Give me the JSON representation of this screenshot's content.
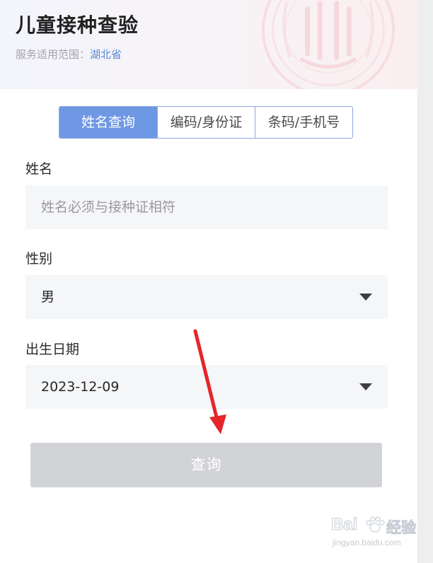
{
  "header": {
    "title": "儿童接种查验",
    "scope_label": "服务适用范围：",
    "scope_value": "湖北省"
  },
  "tabs": [
    {
      "label": "姓名查询",
      "active": true
    },
    {
      "label": "编码/身份证",
      "active": false
    },
    {
      "label": "条码/手机号",
      "active": false
    }
  ],
  "form": {
    "name": {
      "label": "姓名",
      "placeholder": "姓名必须与接种证相符",
      "value": ""
    },
    "gender": {
      "label": "性别",
      "value": "男"
    },
    "birthdate": {
      "label": "出生日期",
      "value": "2023-12-09"
    }
  },
  "submit_label": "查询",
  "watermark": {
    "brand": "Bai",
    "brand_suffix": "经验",
    "url": "jingyan.baidu.com"
  },
  "colors": {
    "accent": "#6f98e4",
    "link": "#5b86d6",
    "annotation_arrow": "#e5252a",
    "button_disabled": "#d2d3d6"
  }
}
